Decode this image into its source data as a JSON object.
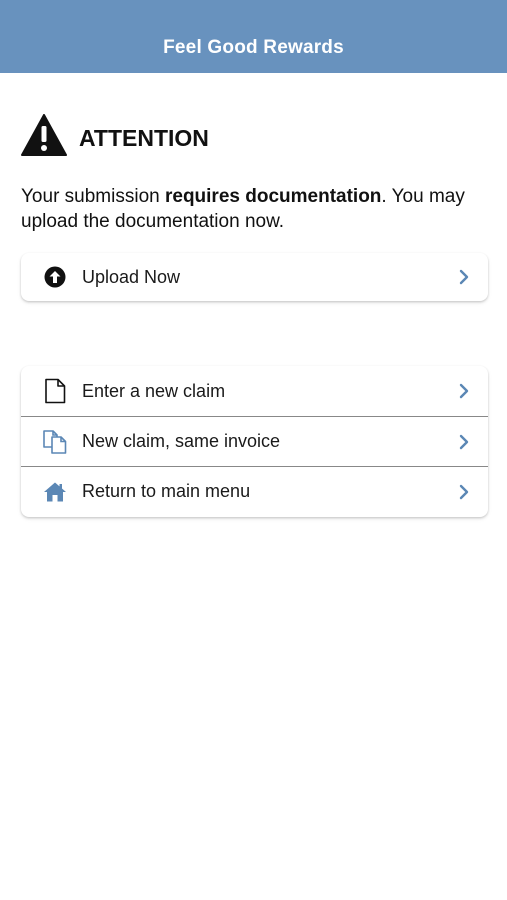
{
  "header": {
    "title": "Feel Good Rewards",
    "background": "#6892be"
  },
  "attention": {
    "icon": "warning-triangle-icon",
    "label": "ATTENTION"
  },
  "message": {
    "before": "Your submission ",
    "bold": "requires documentation",
    "after": ". You may upload the documentation now."
  },
  "upload": {
    "icon": "upload-circle-icon",
    "label": "Upload Now"
  },
  "menu": {
    "items": [
      {
        "icon": "document-icon",
        "label": "Enter a new claim"
      },
      {
        "icon": "copy-documents-icon",
        "label": "New claim, same invoice"
      },
      {
        "icon": "home-icon",
        "label": "Return to main menu"
      }
    ]
  },
  "colors": {
    "accent": "#6892be",
    "chevron": "#5b87b5",
    "divider": "#888888"
  }
}
